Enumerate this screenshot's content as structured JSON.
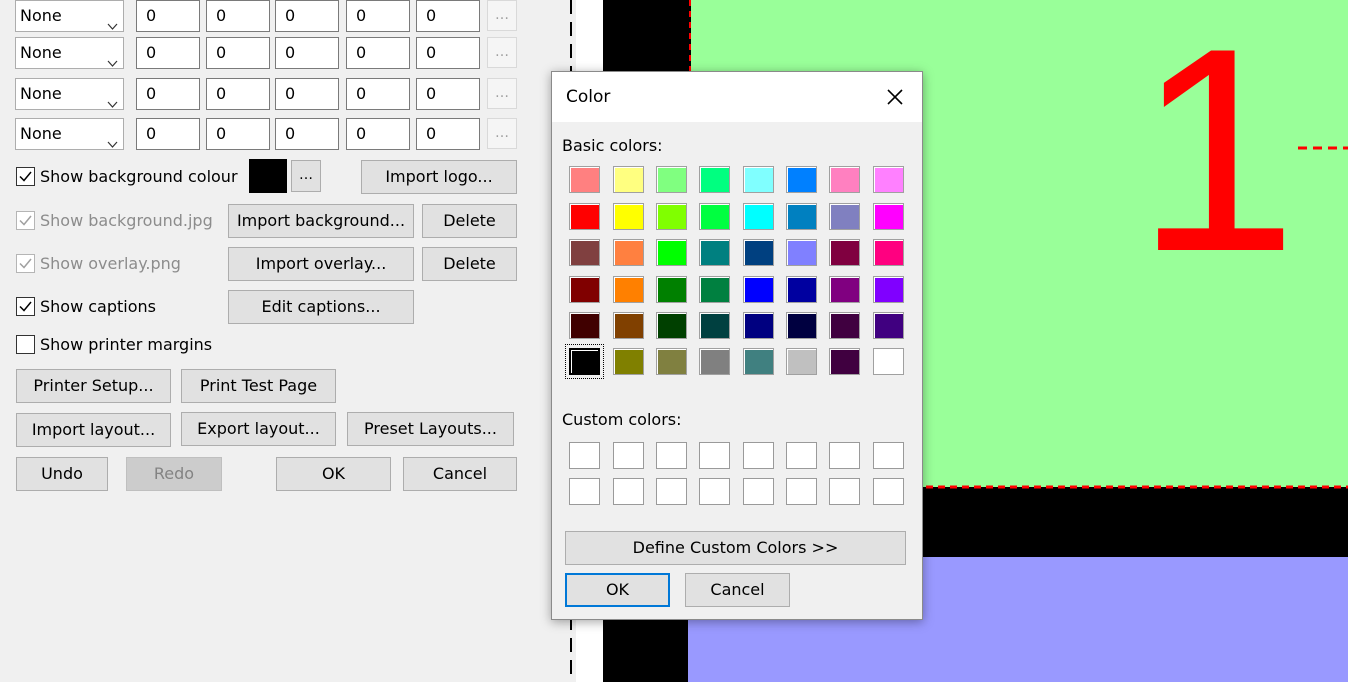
{
  "rows": [
    {
      "select": "None",
      "values": [
        "0",
        "0",
        "0",
        "0",
        "0"
      ],
      "more": "…"
    },
    {
      "select": "None",
      "values": [
        "0",
        "0",
        "0",
        "0",
        "0"
      ],
      "more": "…"
    },
    {
      "select": "None",
      "values": [
        "0",
        "0",
        "0",
        "0",
        "0"
      ],
      "more": "…"
    },
    {
      "select": "None",
      "values": [
        "0",
        "0",
        "0",
        "0",
        "0"
      ],
      "more": "…"
    }
  ],
  "options": {
    "show_bg_colour": "Show background colour",
    "bg_colour_more": "…",
    "import_logo": "Import logo...",
    "show_bg_jpg": "Show background.jpg",
    "import_background": "Import background...",
    "delete_bg": "Delete",
    "show_overlay": "Show overlay.png",
    "import_overlay": "Import overlay...",
    "delete_overlay": "Delete",
    "show_captions": "Show captions",
    "edit_captions": "Edit captions...",
    "show_margins": "Show printer margins",
    "background_colour": "#000000"
  },
  "buttons": {
    "printer_setup": "Printer Setup...",
    "print_test": "Print Test Page",
    "import_layout": "Import layout...",
    "export_layout": "Export layout...",
    "preset_layouts": "Preset Layouts...",
    "undo": "Undo",
    "redo": "Redo",
    "ok": "OK",
    "cancel": "Cancel"
  },
  "preview": {
    "frame_number": "1",
    "frame1_color": "#99ff99",
    "frame2_color": "#9999ff",
    "border_color": "#000000",
    "guide_color": "#ff0000"
  },
  "color_dialog": {
    "title": "Color",
    "basic_label": "Basic colors:",
    "custom_label": "Custom colors:",
    "define_custom": "Define Custom Colors >>",
    "ok": "OK",
    "cancel": "Cancel",
    "selected_color": "#000000",
    "basic_colors": [
      [
        "#ff8080",
        "#ffff80",
        "#80ff80",
        "#00ff80",
        "#80ffff",
        "#0080ff",
        "#ff80c0",
        "#ff80ff"
      ],
      [
        "#ff0000",
        "#ffff00",
        "#80ff00",
        "#00ff40",
        "#00ffff",
        "#0080c0",
        "#8080c0",
        "#ff00ff"
      ],
      [
        "#804040",
        "#ff8040",
        "#00ff00",
        "#008080",
        "#004080",
        "#8080ff",
        "#800040",
        "#ff0080"
      ],
      [
        "#800000",
        "#ff8000",
        "#008000",
        "#008040",
        "#0000ff",
        "#0000a0",
        "#800080",
        "#8000ff"
      ],
      [
        "#400000",
        "#804000",
        "#004000",
        "#004040",
        "#000080",
        "#000040",
        "#400040",
        "#400080"
      ],
      [
        "#000000",
        "#808000",
        "#808040",
        "#808080",
        "#408080",
        "#c0c0c0",
        "#400040",
        "#ffffff"
      ]
    ]
  }
}
